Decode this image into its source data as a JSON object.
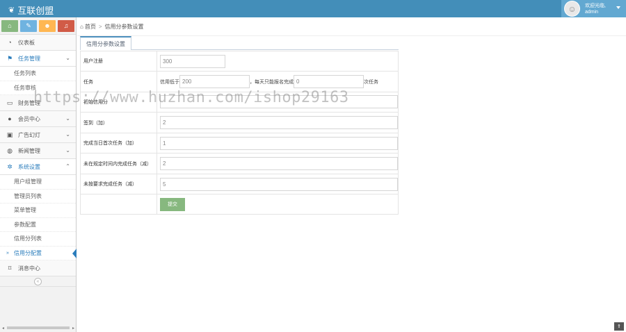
{
  "brand": {
    "name": "互联创盟",
    "icon": "leaf-icon"
  },
  "user": {
    "greeting": "欢迎光临,",
    "name": "admin"
  },
  "shortcuts": [
    {
      "icon": "home-icon",
      "color": "#87b87f"
    },
    {
      "icon": "pencil-icon",
      "color": "#6fb3e0"
    },
    {
      "icon": "users-icon",
      "color": "#ffb752"
    },
    {
      "icon": "bell-icon",
      "color": "#d15b47"
    }
  ],
  "sidebar": {
    "dashboard": "仪表板",
    "task_mgmt": "任务管理",
    "task_list": "任务列表",
    "task_review": "任务审核",
    "finance": "财务管理",
    "members": "会员中心",
    "ads": "广告幻灯",
    "news": "新闻管理",
    "system": "系统设置",
    "user_group": "用户组管理",
    "admin_list": "管理员列表",
    "menu_mgmt": "菜单管理",
    "params": "参数配置",
    "credit_list": "信用分列表",
    "credit_config": "信用分配置",
    "messages": "消息中心"
  },
  "breadcrumb": {
    "home": "首页",
    "current": "信用分参数设置"
  },
  "tab": {
    "label": "信用分参数设置"
  },
  "form": {
    "register_label": "用户注册",
    "register_value": "300",
    "task_label": "任务",
    "task_prefix": "信用低于",
    "task_credit": "200",
    "task_mid": "，每天只能报名完成",
    "task_count": "0",
    "task_suffix": "次任务",
    "initial_label": "初始信用分",
    "checkin_label": "签到（加）",
    "checkin_value": "2",
    "first_task_label": "完成当日首次任务（加）",
    "first_task_value": "1",
    "overdue_label": "未在规定时间内完成任务（减）",
    "overdue_value": "2",
    "noncompliant_label": "未按要求完成任务（减）",
    "noncompliant_value": "5",
    "submit_label": "提交"
  },
  "watermark": "https://www.huzhan.com/ishop29163",
  "colors": {
    "navbar": "#438eb9",
    "accent": "#2b7dbc",
    "submit": "#87b87f"
  }
}
